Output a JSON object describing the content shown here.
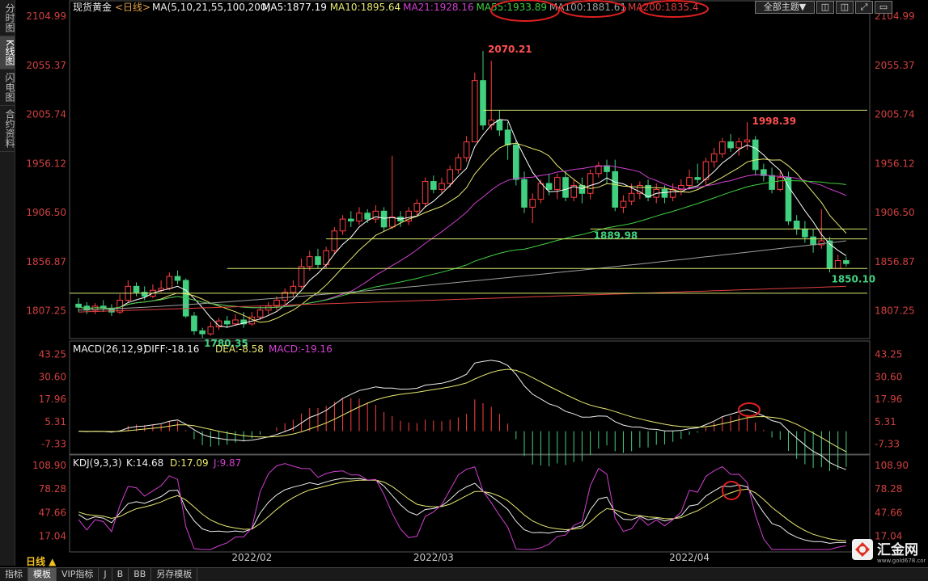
{
  "left_tabs": [
    "分时图",
    "K线图",
    "闪电图",
    "合约资料"
  ],
  "active_left_tab": 1,
  "top_buttons": [
    {
      "label": "全部主题▼"
    },
    {
      "label": "◫"
    },
    {
      "label": "◫"
    },
    {
      "label": "⤢"
    },
    {
      "label": "▭"
    }
  ],
  "price_panel": {
    "instrument": "现货黄金",
    "period_tag": "<日线>",
    "ma_params": "MA(5,10,21,55,100,200)",
    "ma_values": [
      {
        "label": "MA5:1877.19",
        "color": "#ffffff"
      },
      {
        "label": "MA10:1895.64",
        "color": "#e8e870"
      },
      {
        "label": "MA21:1928.16",
        "color": "#d040d0"
      },
      {
        "label": "MA55:1933.89",
        "color": "#40d040"
      },
      {
        "label": "MA100:1881.61",
        "color": "#a0a0a0"
      },
      {
        "label": "MA200:1835.4",
        "color": "#e04040"
      }
    ],
    "y_ticks": [
      "2104.99",
      "2055.37",
      "2005.74",
      "1956.12",
      "1906.50",
      "1856.87",
      "1807.25"
    ],
    "annotations": [
      "2070.21",
      "1998.39",
      "1889.98",
      "1850.10",
      "1780.35"
    ]
  },
  "macd_panel": {
    "title": "MACD(26,12,9)",
    "diff": "DIFF:-18.16",
    "dea": "DEA:-8.58",
    "macd": "MACD:-19.16",
    "y_ticks": [
      "43.25",
      "30.60",
      "17.96",
      "5.31",
      "-7.33"
    ]
  },
  "kdj_panel": {
    "title": "KDJ(9,3,3)",
    "k": "K:14.68",
    "d": "D:17.09",
    "j": "J:9.87",
    "y_ticks": [
      "108.90",
      "78.28",
      "47.66",
      "17.04"
    ]
  },
  "x_labels": [
    "2022/02",
    "2022/03",
    "2022/04"
  ],
  "period_label": "日线 ▲",
  "bottom_tabs": [
    "指标",
    "模板",
    "VIP指标",
    "J",
    "B",
    "BB",
    "另存模板"
  ],
  "active_bottom_tab": 1,
  "logo": {
    "name": "汇金网",
    "url": "www.gold678.com"
  },
  "chart_data": {
    "type": "candlestick",
    "title": "现货黄金 <日线>",
    "ylim": [
      1780,
      2110
    ],
    "candles": [
      [
        1814,
        1811,
        1820,
        1806
      ],
      [
        1812,
        1808,
        1816,
        1804
      ],
      [
        1808,
        1812,
        1815,
        1804
      ],
      [
        1812,
        1810,
        1818,
        1806
      ],
      [
        1810,
        1806,
        1814,
        1802
      ],
      [
        1806,
        1818,
        1824,
        1804
      ],
      [
        1818,
        1832,
        1838,
        1816
      ],
      [
        1832,
        1826,
        1836,
        1822
      ],
      [
        1826,
        1822,
        1832,
        1818
      ],
      [
        1822,
        1828,
        1834,
        1820
      ],
      [
        1828,
        1830,
        1838,
        1826
      ],
      [
        1830,
        1842,
        1846,
        1828
      ],
      [
        1842,
        1838,
        1848,
        1834
      ],
      [
        1838,
        1802,
        1840,
        1800
      ],
      [
        1802,
        1787,
        1806,
        1783
      ],
      [
        1787,
        1784,
        1790,
        1780
      ],
      [
        1784,
        1791,
        1796,
        1782
      ],
      [
        1791,
        1797,
        1800,
        1788
      ],
      [
        1797,
        1794,
        1802,
        1790
      ],
      [
        1794,
        1798,
        1804,
        1792
      ],
      [
        1798,
        1794,
        1806,
        1790
      ],
      [
        1794,
        1801,
        1806,
        1792
      ],
      [
        1801,
        1808,
        1812,
        1798
      ],
      [
        1808,
        1812,
        1816,
        1804
      ],
      [
        1812,
        1818,
        1822,
        1808
      ],
      [
        1818,
        1826,
        1830,
        1814
      ],
      [
        1826,
        1832,
        1838,
        1822
      ],
      [
        1832,
        1852,
        1860,
        1830
      ],
      [
        1852,
        1862,
        1868,
        1848
      ],
      [
        1862,
        1854,
        1870,
        1850
      ],
      [
        1854,
        1868,
        1872,
        1850
      ],
      [
        1868,
        1888,
        1892,
        1864
      ],
      [
        1888,
        1900,
        1904,
        1884
      ],
      [
        1900,
        1898,
        1908,
        1892
      ],
      [
        1898,
        1906,
        1912,
        1894
      ],
      [
        1906,
        1900,
        1910,
        1896
      ],
      [
        1900,
        1908,
        1914,
        1896
      ],
      [
        1908,
        1892,
        1912,
        1888
      ],
      [
        1892,
        1902,
        1964,
        1890
      ],
      [
        1902,
        1898,
        1908,
        1892
      ],
      [
        1898,
        1908,
        1912,
        1894
      ],
      [
        1908,
        1916,
        1920,
        1904
      ],
      [
        1916,
        1938,
        1942,
        1912
      ],
      [
        1938,
        1930,
        1944,
        1926
      ],
      [
        1930,
        1936,
        1942,
        1926
      ],
      [
        1936,
        1950,
        1954,
        1932
      ],
      [
        1950,
        1962,
        1966,
        1946
      ],
      [
        1962,
        1978,
        1984,
        1958
      ],
      [
        1978,
        2040,
        2048,
        2000
      ],
      [
        2040,
        1995,
        2070,
        1990
      ],
      [
        1995,
        2000,
        2060,
        1990
      ],
      [
        2000,
        1990,
        2010,
        1984
      ],
      [
        1990,
        1975,
        1998,
        1960
      ],
      [
        1975,
        1940,
        1980,
        1934
      ],
      [
        1940,
        1912,
        1948,
        1906
      ],
      [
        1912,
        1920,
        1926,
        1896
      ],
      [
        1920,
        1936,
        1940,
        1916
      ],
      [
        1936,
        1930,
        1946,
        1924
      ],
      [
        1930,
        1942,
        1946,
        1920
      ],
      [
        1942,
        1922,
        1948,
        1918
      ],
      [
        1922,
        1934,
        1940,
        1918
      ],
      [
        1934,
        1926,
        1942,
        1916
      ],
      [
        1926,
        1946,
        1950,
        1920
      ],
      [
        1946,
        1954,
        1958,
        1942
      ],
      [
        1954,
        1948,
        1960,
        1936
      ],
      [
        1948,
        1912,
        1960,
        1908
      ],
      [
        1912,
        1918,
        1924,
        1906
      ],
      [
        1918,
        1926,
        1936,
        1914
      ],
      [
        1926,
        1934,
        1938,
        1920
      ],
      [
        1934,
        1922,
        1940,
        1918
      ],
      [
        1922,
        1930,
        1936,
        1916
      ],
      [
        1930,
        1922,
        1934,
        1916
      ],
      [
        1922,
        1930,
        1936,
        1918
      ],
      [
        1930,
        1934,
        1940,
        1924
      ],
      [
        1934,
        1942,
        1950,
        1930
      ],
      [
        1942,
        1940,
        1956,
        1936
      ],
      [
        1940,
        1958,
        1962,
        1934
      ],
      [
        1958,
        1966,
        1972,
        1952
      ],
      [
        1966,
        1978,
        1982,
        1962
      ],
      [
        1978,
        1972,
        1986,
        1968
      ],
      [
        1972,
        1978,
        1982,
        1964
      ],
      [
        1978,
        1980,
        1998,
        1970
      ],
      [
        1980,
        1950,
        1984,
        1944
      ],
      [
        1950,
        1944,
        1956,
        1938
      ],
      [
        1944,
        1930,
        1952,
        1926
      ],
      [
        1930,
        1942,
        1948,
        1928
      ],
      [
        1942,
        1898,
        1948,
        1894
      ],
      [
        1898,
        1890,
        1904,
        1884
      ],
      [
        1890,
        1882,
        1898,
        1876
      ],
      [
        1882,
        1874,
        1890,
        1866
      ],
      [
        1874,
        1878,
        1910,
        1870
      ],
      [
        1878,
        1850,
        1882,
        1846
      ],
      [
        1850,
        1858,
        1864,
        1850
      ],
      [
        1858,
        1855,
        1862,
        1852
      ]
    ],
    "moving_averages": [
      "MA5",
      "MA10",
      "MA21",
      "MA55",
      "MA100",
      "MA200"
    ],
    "levels": [
      2010,
      1880,
      1890,
      1850,
      1825
    ]
  }
}
